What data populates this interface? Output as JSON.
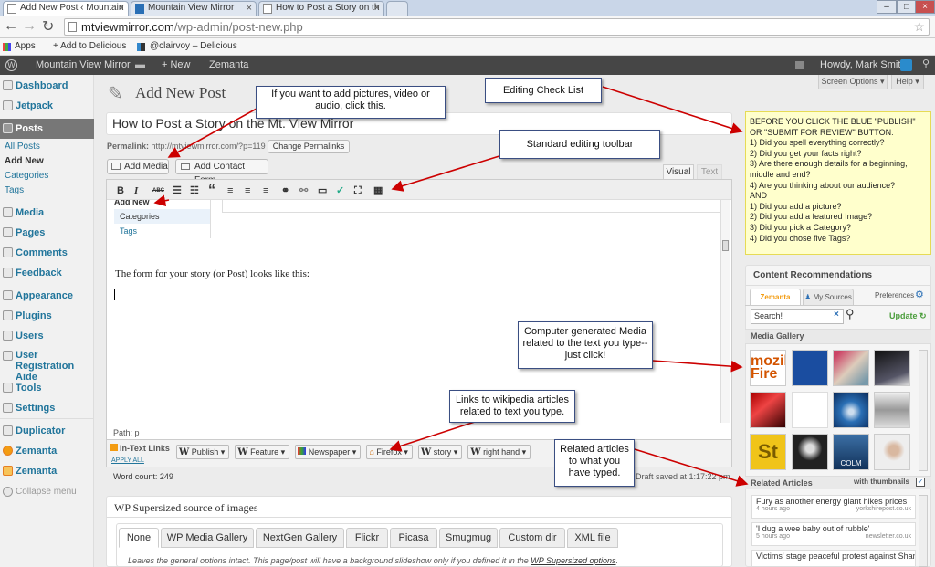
{
  "browser": {
    "tabs": [
      {
        "label": "Add New Post ‹ Mountain",
        "active": true
      },
      {
        "label": "Mountain View Mirror",
        "active": false
      },
      {
        "label": "How to Post a Story on th",
        "active": false
      }
    ],
    "url_host": "mtviewmirror.com",
    "url_path": "/wp-admin/post-new.php",
    "bookmarks": [
      "Apps",
      "+ Add to Delicious",
      "@clairvoy – Delicious"
    ]
  },
  "adminbar": {
    "site": "Mountain View Mirror",
    "new": "+ New",
    "zemanta": "Zemanta",
    "howdy": "Howdy, Mark Smith"
  },
  "sidebar": {
    "items": [
      "Dashboard",
      "Jetpack",
      "Posts",
      "Media",
      "Pages",
      "Comments",
      "Feedback",
      "Appearance",
      "Plugins",
      "Users",
      "User Registration Aide",
      "Tools",
      "Settings",
      "Duplicator",
      "Zemanta",
      "Zemanta",
      "Collapse menu"
    ],
    "posts_sub": [
      "All Posts",
      "Add New",
      "Categories",
      "Tags"
    ]
  },
  "page": {
    "title": "Add New Post",
    "screen_options": "Screen Options ▾",
    "help": "Help ▾",
    "post_title": "How to Post a Story on the Mt. View Mirror",
    "permalink_label": "Permalink:",
    "permalink_url": "http://mtviewmirror.com/?p=119",
    "change_permalinks": "Change Permalinks",
    "add_media": "Add Media",
    "add_contact_form": "Add Contact Form",
    "tab_visual": "Visual",
    "tab_text": "Text"
  },
  "toolbar": {
    "bold": "B",
    "italic": "I",
    "strike": "ABC",
    "quote": "“"
  },
  "editor": {
    "dropdown_items": [
      "Add New",
      "Categories",
      "Tags"
    ],
    "body_text": "The form for your story (or Post) looks like this:",
    "path": "Path: p",
    "word_count": "Word count: 249",
    "draft_saved": "Draft saved at 1:17:22 pm."
  },
  "intext": {
    "title": "In-Text Links",
    "apply_all": "APPLY ALL",
    "links": [
      "Publish",
      "Feature",
      "Newspaper",
      "Firefox",
      "story",
      "right hand"
    ]
  },
  "checklist": {
    "text": "BEFORE YOU CLICK THE BLUE \"PUBLISH\" OR \"SUBMIT FOR REVIEW\" BUTTON:\n1) Did you spell everything correctly?\n2) Did you get your facts right?\n3) Are there enough details for a beginning, middle and end?\n4) Are you thinking about our audience?\nAND\n1) Did you add a picture?\n2) Did you add a featured Image?\n3) Did you pick a Category?\n4) Did you chose five Tags?"
  },
  "recommend": {
    "title": "Content Recommendations",
    "tab_zemanta": "Zemanta",
    "tab_sources": "My Sources",
    "preferences": "Preferences",
    "search_value": "Search!",
    "update": "Update",
    "media_gallery": "Media Gallery",
    "gallery_labels": [
      "mozill\nFire",
      "",
      "",
      "",
      "",
      "",
      "",
      "",
      "St",
      "",
      "",
      "COLM",
      ""
    ],
    "related_title": "Related Articles",
    "with_thumbnails": "with thumbnails",
    "articles": [
      {
        "title": "Fury as another energy giant hikes prices",
        "age": "4 hours ago",
        "source": "yorkshirepost.co.uk"
      },
      {
        "title": "'I dug a wee baby out of rubble'",
        "age": "5 hours ago",
        "source": "newsletter.co.uk"
      },
      {
        "title": "Victims' stage peaceful protest against Shankill b",
        "age": "",
        "source": ""
      }
    ]
  },
  "supersized": {
    "title": "WP Supersized source of images",
    "tabs": [
      "None",
      "WP Media Gallery",
      "NextGen Gallery",
      "Flickr",
      "Picasa",
      "Smugmug",
      "Custom dir",
      "XML file"
    ],
    "note": "Leaves the general options intact. This page/post will have a background slideshow only if you defined it in the",
    "link": "WP Supersized options"
  },
  "callouts": {
    "pictures": "If you want to add pictures, video or audio, click this.",
    "checklist": "Editing Check List",
    "toolbar": "Standard editing toolbar",
    "media": "Computer generated Media related to the text you type--just click!",
    "wiki": "Links to wikipedia articles related to text you type.",
    "related": "Related articles to what you have typed."
  }
}
